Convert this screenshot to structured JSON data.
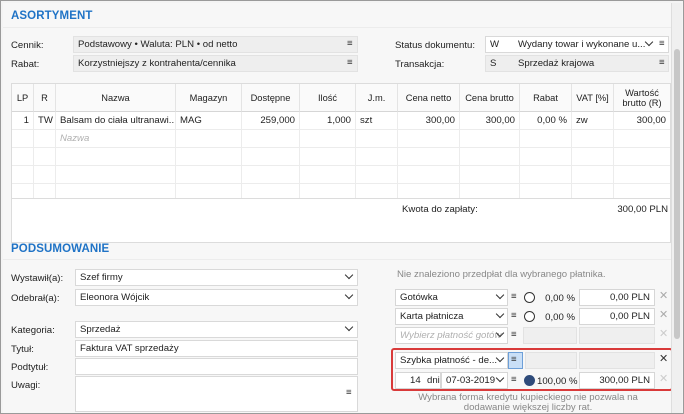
{
  "assortment": {
    "title": "ASORTYMENT",
    "price_list_label": "Cennik:",
    "price_list_value": "Podstawowy • Waluta: PLN • od netto",
    "discount_label": "Rabat:",
    "discount_value": "Korzystniejszy z kontrahenta/cennika",
    "doc_status_label": "Status dokumentu:",
    "doc_status_code": "W",
    "doc_status_value": "Wydany towar i wykonane u...",
    "transaction_label": "Transakcja:",
    "transaction_code": "S",
    "transaction_value": "Sprzedaż krajowa"
  },
  "grid": {
    "columns": [
      "LP",
      "R",
      "Nazwa",
      "Magazyn",
      "Dostępne",
      "Ilość",
      "J.m.",
      "Cena netto",
      "Cena brutto",
      "Rabat",
      "VAT [%]",
      "Wartość brutto (R)"
    ],
    "rows": [
      {
        "lp": "1",
        "r": "TW",
        "name": "Balsam do ciała ultranawi...",
        "warehouse": "MAG",
        "available": "259,000",
        "qty": "1,000",
        "unit": "szt",
        "net": "300,00",
        "gross": "300,00",
        "discount": "0,00 %",
        "vat": "zw",
        "value": "300,00"
      }
    ],
    "new_row_placeholder": "Nazwa",
    "total_label": "Kwota do zapłaty:",
    "total_value": "300,00 PLN"
  },
  "summary": {
    "title": "PODSUMOWANIE",
    "issued_by_label": "Wystawił(a):",
    "issued_by_value": "Szef firmy",
    "received_by_label": "Odebrał(a):",
    "received_by_value": "Eleonora Wójcik",
    "category_label": "Kategoria:",
    "category_value": "Sprzedaż",
    "title_label": "Tytuł:",
    "title_value": "Faktura VAT sprzedaży",
    "subtitle_label": "Podtytuł:",
    "notes_label": "Uwagi:"
  },
  "payments": {
    "no_prepayments": "Nie znaleziono przedpłat dla wybranego płatnika.",
    "rows": [
      {
        "method": "Gotówka",
        "percent": "0,00 %",
        "amount": "0,00 PLN"
      },
      {
        "method": "Karta płatnicza",
        "percent": "0,00 %",
        "amount": "0,00 PLN"
      }
    ],
    "choose_placeholder": "Wybierz płatność gotów",
    "credit_method": "Szybka płatność - de...",
    "credit_days": "14",
    "credit_days_unit": "dni",
    "credit_date": "07-03-2019",
    "credit_percent": "100,00 %",
    "credit_amount": "300,00 PLN",
    "credit_note": "Wybrana forma kredytu kupieckiego nie pozwala na dodawanie większej liczby rat."
  },
  "icons": {
    "menu": "≡",
    "close": "✕"
  }
}
